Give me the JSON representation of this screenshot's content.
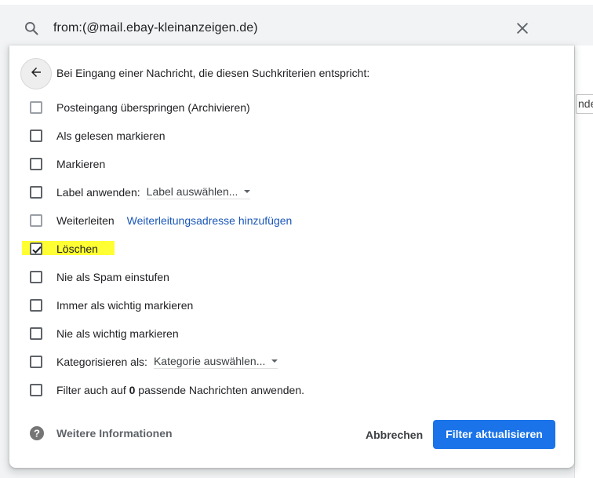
{
  "search": {
    "query": "from:(@mail.ebay-kleinanzeigen.de)"
  },
  "background": {
    "peek_text": "nde"
  },
  "dialog": {
    "heading": "Bei Eingang einer Nachricht, die diesen Suchkriterien entspricht:",
    "options": [
      {
        "label": "Posteingang überspringen (Archivieren)",
        "checked": false
      },
      {
        "label": "Als gelesen markieren",
        "checked": false
      },
      {
        "label": "Markieren",
        "checked": false
      },
      {
        "label": "Label anwenden:",
        "checked": false,
        "select_value": "Label auswählen..."
      },
      {
        "label": "Weiterleiten",
        "checked": false,
        "link": "Weiterleitungsadresse hinzufügen"
      },
      {
        "label": "Löschen",
        "checked": true,
        "highlighted": true
      },
      {
        "label": "Nie als Spam einstufen",
        "checked": false
      },
      {
        "label": "Immer als wichtig markieren",
        "checked": false
      },
      {
        "label": "Nie als wichtig markieren",
        "checked": false
      },
      {
        "label": "Kategorisieren als:",
        "checked": false,
        "select_value": "Kategorie auswählen..."
      },
      {
        "label_before": "Filter auch auf ",
        "count": "0",
        "label_after": " passende Nachrichten anwenden.",
        "checked": false
      }
    ],
    "footer": {
      "help_label": "Weitere Informationen",
      "cancel_label": "Abbrechen",
      "submit_label": "Filter aktualisieren"
    }
  },
  "colors": {
    "primary": "#1a73e8",
    "link": "#1a57b8",
    "highlight": "#ffff33"
  }
}
